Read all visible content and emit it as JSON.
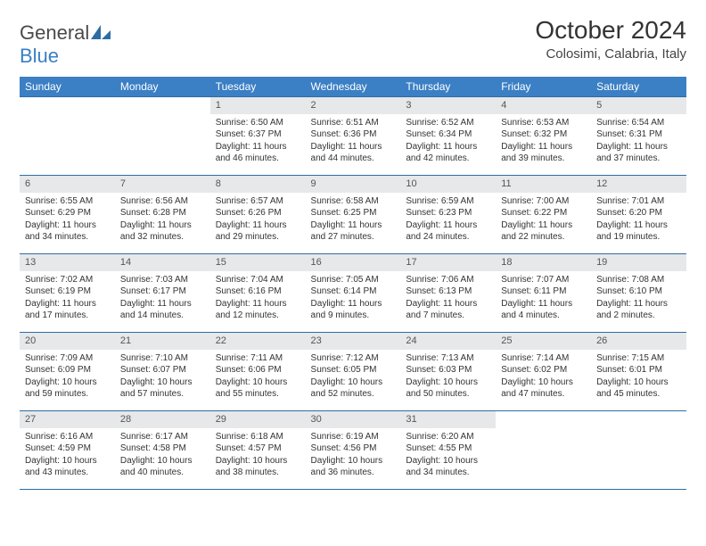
{
  "brand": {
    "part1": "General",
    "part2": "Blue"
  },
  "title": "October 2024",
  "location": "Colosimi, Calabria, Italy",
  "weekdays": [
    "Sunday",
    "Monday",
    "Tuesday",
    "Wednesday",
    "Thursday",
    "Friday",
    "Saturday"
  ],
  "weeks": [
    [
      null,
      null,
      {
        "n": "1",
        "sr": "Sunrise: 6:50 AM",
        "ss": "Sunset: 6:37 PM",
        "dl": "Daylight: 11 hours and 46 minutes."
      },
      {
        "n": "2",
        "sr": "Sunrise: 6:51 AM",
        "ss": "Sunset: 6:36 PM",
        "dl": "Daylight: 11 hours and 44 minutes."
      },
      {
        "n": "3",
        "sr": "Sunrise: 6:52 AM",
        "ss": "Sunset: 6:34 PM",
        "dl": "Daylight: 11 hours and 42 minutes."
      },
      {
        "n": "4",
        "sr": "Sunrise: 6:53 AM",
        "ss": "Sunset: 6:32 PM",
        "dl": "Daylight: 11 hours and 39 minutes."
      },
      {
        "n": "5",
        "sr": "Sunrise: 6:54 AM",
        "ss": "Sunset: 6:31 PM",
        "dl": "Daylight: 11 hours and 37 minutes."
      }
    ],
    [
      {
        "n": "6",
        "sr": "Sunrise: 6:55 AM",
        "ss": "Sunset: 6:29 PM",
        "dl": "Daylight: 11 hours and 34 minutes."
      },
      {
        "n": "7",
        "sr": "Sunrise: 6:56 AM",
        "ss": "Sunset: 6:28 PM",
        "dl": "Daylight: 11 hours and 32 minutes."
      },
      {
        "n": "8",
        "sr": "Sunrise: 6:57 AM",
        "ss": "Sunset: 6:26 PM",
        "dl": "Daylight: 11 hours and 29 minutes."
      },
      {
        "n": "9",
        "sr": "Sunrise: 6:58 AM",
        "ss": "Sunset: 6:25 PM",
        "dl": "Daylight: 11 hours and 27 minutes."
      },
      {
        "n": "10",
        "sr": "Sunrise: 6:59 AM",
        "ss": "Sunset: 6:23 PM",
        "dl": "Daylight: 11 hours and 24 minutes."
      },
      {
        "n": "11",
        "sr": "Sunrise: 7:00 AM",
        "ss": "Sunset: 6:22 PM",
        "dl": "Daylight: 11 hours and 22 minutes."
      },
      {
        "n": "12",
        "sr": "Sunrise: 7:01 AM",
        "ss": "Sunset: 6:20 PM",
        "dl": "Daylight: 11 hours and 19 minutes."
      }
    ],
    [
      {
        "n": "13",
        "sr": "Sunrise: 7:02 AM",
        "ss": "Sunset: 6:19 PM",
        "dl": "Daylight: 11 hours and 17 minutes."
      },
      {
        "n": "14",
        "sr": "Sunrise: 7:03 AM",
        "ss": "Sunset: 6:17 PM",
        "dl": "Daylight: 11 hours and 14 minutes."
      },
      {
        "n": "15",
        "sr": "Sunrise: 7:04 AM",
        "ss": "Sunset: 6:16 PM",
        "dl": "Daylight: 11 hours and 12 minutes."
      },
      {
        "n": "16",
        "sr": "Sunrise: 7:05 AM",
        "ss": "Sunset: 6:14 PM",
        "dl": "Daylight: 11 hours and 9 minutes."
      },
      {
        "n": "17",
        "sr": "Sunrise: 7:06 AM",
        "ss": "Sunset: 6:13 PM",
        "dl": "Daylight: 11 hours and 7 minutes."
      },
      {
        "n": "18",
        "sr": "Sunrise: 7:07 AM",
        "ss": "Sunset: 6:11 PM",
        "dl": "Daylight: 11 hours and 4 minutes."
      },
      {
        "n": "19",
        "sr": "Sunrise: 7:08 AM",
        "ss": "Sunset: 6:10 PM",
        "dl": "Daylight: 11 hours and 2 minutes."
      }
    ],
    [
      {
        "n": "20",
        "sr": "Sunrise: 7:09 AM",
        "ss": "Sunset: 6:09 PM",
        "dl": "Daylight: 10 hours and 59 minutes."
      },
      {
        "n": "21",
        "sr": "Sunrise: 7:10 AM",
        "ss": "Sunset: 6:07 PM",
        "dl": "Daylight: 10 hours and 57 minutes."
      },
      {
        "n": "22",
        "sr": "Sunrise: 7:11 AM",
        "ss": "Sunset: 6:06 PM",
        "dl": "Daylight: 10 hours and 55 minutes."
      },
      {
        "n": "23",
        "sr": "Sunrise: 7:12 AM",
        "ss": "Sunset: 6:05 PM",
        "dl": "Daylight: 10 hours and 52 minutes."
      },
      {
        "n": "24",
        "sr": "Sunrise: 7:13 AM",
        "ss": "Sunset: 6:03 PM",
        "dl": "Daylight: 10 hours and 50 minutes."
      },
      {
        "n": "25",
        "sr": "Sunrise: 7:14 AM",
        "ss": "Sunset: 6:02 PM",
        "dl": "Daylight: 10 hours and 47 minutes."
      },
      {
        "n": "26",
        "sr": "Sunrise: 7:15 AM",
        "ss": "Sunset: 6:01 PM",
        "dl": "Daylight: 10 hours and 45 minutes."
      }
    ],
    [
      {
        "n": "27",
        "sr": "Sunrise: 6:16 AM",
        "ss": "Sunset: 4:59 PM",
        "dl": "Daylight: 10 hours and 43 minutes."
      },
      {
        "n": "28",
        "sr": "Sunrise: 6:17 AM",
        "ss": "Sunset: 4:58 PM",
        "dl": "Daylight: 10 hours and 40 minutes."
      },
      {
        "n": "29",
        "sr": "Sunrise: 6:18 AM",
        "ss": "Sunset: 4:57 PM",
        "dl": "Daylight: 10 hours and 38 minutes."
      },
      {
        "n": "30",
        "sr": "Sunrise: 6:19 AM",
        "ss": "Sunset: 4:56 PM",
        "dl": "Daylight: 10 hours and 36 minutes."
      },
      {
        "n": "31",
        "sr": "Sunrise: 6:20 AM",
        "ss": "Sunset: 4:55 PM",
        "dl": "Daylight: 10 hours and 34 minutes."
      },
      null,
      null
    ]
  ]
}
